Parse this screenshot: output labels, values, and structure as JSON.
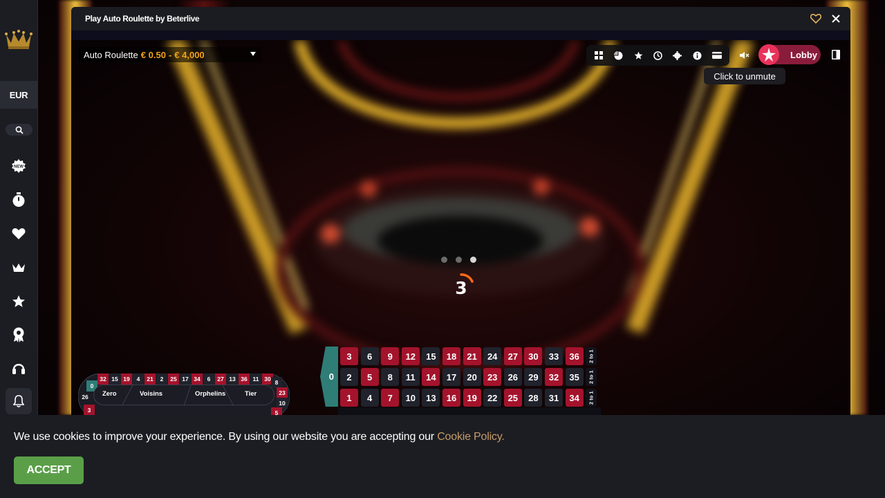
{
  "sidebar": {
    "currency": "EUR",
    "icons": [
      "crown-logo-icon",
      "search-icon",
      "new-games-icon",
      "timer-icon",
      "heart-icon",
      "crown-icon",
      "star-icon",
      "award-icon",
      "headset-icon",
      "bell-icon"
    ]
  },
  "game_window": {
    "title": "Play Auto Roulette by Beterlive",
    "table": {
      "name": "Auto Roulette",
      "limit_min": "€ 0.50",
      "separator": "-",
      "limit_max": "€ 4,000"
    },
    "toolbar_icons": [
      "grid-icon",
      "statistics-icon",
      "star-icon",
      "history-icon",
      "settings-icon",
      "info-icon",
      "wallet-icon"
    ],
    "lobby_label": "Lobby",
    "tooltip": "Click to unmute",
    "countdown": "3",
    "loader_dots": 3
  },
  "racetrack": {
    "top": [
      "32",
      "15",
      "19",
      "4",
      "21",
      "2",
      "25",
      "17",
      "34",
      "6",
      "27",
      "13",
      "36",
      "11",
      "30"
    ],
    "left": [
      "0",
      "26",
      "3"
    ],
    "right": [
      "8",
      "23",
      "10",
      "5"
    ],
    "sectors": [
      "Zero",
      "Voisins",
      "Orphelins",
      "Tier"
    ]
  },
  "betting_grid": {
    "zero": "0",
    "rows": [
      [
        "3",
        "6",
        "9",
        "12",
        "15",
        "18",
        "21",
        "24",
        "27",
        "30",
        "33",
        "36"
      ],
      [
        "2",
        "5",
        "8",
        "11",
        "14",
        "17",
        "20",
        "23",
        "26",
        "29",
        "32",
        "35"
      ],
      [
        "1",
        "4",
        "7",
        "10",
        "13",
        "16",
        "19",
        "22",
        "25",
        "28",
        "31",
        "34"
      ]
    ],
    "column_bet": "2 to 1",
    "red_numbers": [
      "1",
      "3",
      "5",
      "7",
      "9",
      "12",
      "14",
      "16",
      "18",
      "19",
      "21",
      "23",
      "25",
      "27",
      "30",
      "32",
      "34",
      "36"
    ]
  },
  "cookie_banner": {
    "text": "We use cookies to improve your experience. By using our website you are accepting our",
    "link_text": "Cookie Policy.",
    "accept_label": "ACCEPT"
  },
  "colors": {
    "red": "#a4132c",
    "black": "#20222c",
    "green": "#2e7d77",
    "limit": "#f2a21b",
    "lobby": "#8a1c3b",
    "accept": "#5a9f48",
    "cookie_link": "#c59c6a"
  }
}
